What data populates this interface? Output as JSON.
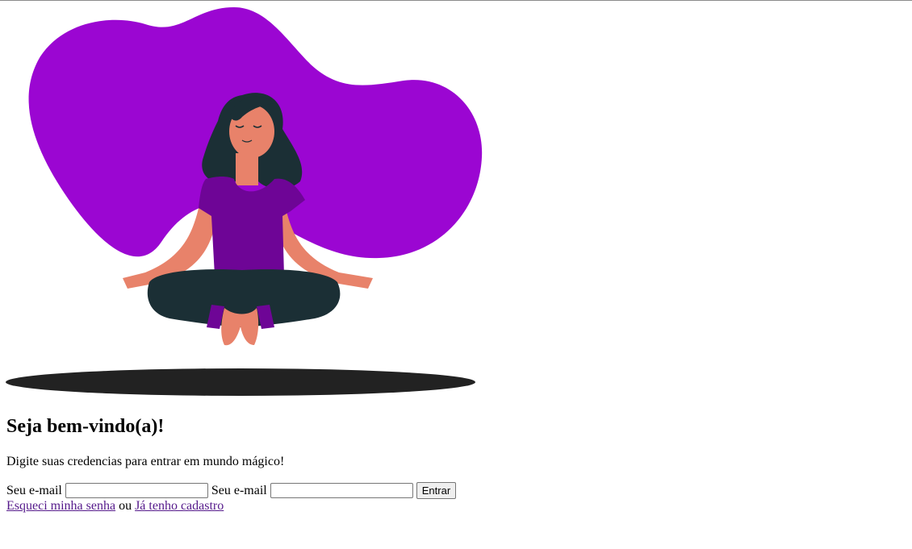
{
  "colors": {
    "blob": "#9b06d2",
    "shadow": "#222222",
    "hair": "#1b2f35",
    "skin": "#e8826a",
    "shirt": "#6e0596",
    "pants": "#1b2f35",
    "link_visited": "#551a8b"
  },
  "illustration": {
    "icon": "meditating-woman-illustration"
  },
  "welcome": {
    "heading": "Seja bem-vindo(a)!",
    "subtitle": "Digite suas credencias para entrar em mundo mágico!"
  },
  "form": {
    "email_label_1": "Seu e-mail",
    "email_value_1": "",
    "email_label_2": "Seu e-mail",
    "email_value_2": "",
    "submit_label": "Entrar"
  },
  "links": {
    "forgot_password": "Esqueci minha senha",
    "separator": " ou ",
    "already_registered": "Já tenho cadastro"
  }
}
